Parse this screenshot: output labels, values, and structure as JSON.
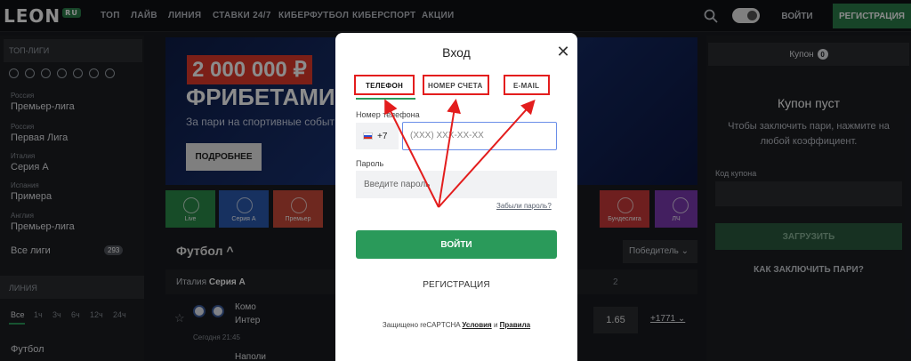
{
  "header": {
    "logo": "LEON",
    "logo_badge": "RU",
    "nav": [
      "ТОП",
      "ЛАЙВ",
      "ЛИНИЯ",
      "СТАВКИ 24/7",
      "КИБЕРФУТБОЛ",
      "КИБЕРСПОРТ",
      "АКЦИИ"
    ],
    "login": "ВОЙТИ",
    "register": "РЕГИСТРАЦИЯ"
  },
  "sidebar": {
    "top_leagues": "ТОП-ЛИГИ",
    "leagues": [
      {
        "country": "Россия",
        "name": "Премьер-лига"
      },
      {
        "country": "Россия",
        "name": "Первая Лига"
      },
      {
        "country": "Италия",
        "name": "Серия A"
      },
      {
        "country": "Испания",
        "name": "Примера"
      },
      {
        "country": "Англия",
        "name": "Премьер-лига"
      }
    ],
    "all_leagues": "Все лиги",
    "all_count": "293",
    "line": "ЛИНИЯ",
    "filters": [
      "Все",
      "1ч",
      "3ч",
      "6ч",
      "12ч",
      "24ч"
    ],
    "sport": "Футбол"
  },
  "banner": {
    "amount": "2 000 000 ₽",
    "title": "ФРИБЕТАМИ",
    "subtitle": "За пари на спортивные событ",
    "button": "ПОДРОБНЕЕ"
  },
  "tiles": [
    {
      "label": "Live",
      "color": "#2a8a4a"
    },
    {
      "label": "Серия А",
      "color": "#2a5ab0"
    },
    {
      "label": "Премьер",
      "color": "#c84a3a"
    },
    {
      "label": "Бундеслига",
      "color": "#c83a3a"
    },
    {
      "label": "ЛЧ",
      "color": "#7a3ab0"
    }
  ],
  "main": {
    "section": "Футбол",
    "sort": "Победитель",
    "league_country": "Италия",
    "league_name": "Серия A",
    "col_header": "2",
    "team1": "Комо",
    "team2": "Интер",
    "team3": "Наполи",
    "match_date": "Сегодня 21:45",
    "odds": "1.65",
    "more_markets": "+1771"
  },
  "coupon": {
    "title": "Купон",
    "count": "0",
    "empty_title": "Купон пуст",
    "empty_text": "Чтобы заключить пари, нажмите на любой коэффициент.",
    "code_label": "Код купона",
    "load": "ЗАГРУЗИТЬ",
    "how": "КАК ЗАКЛЮЧИТЬ ПАРИ?"
  },
  "modal": {
    "title": "Вход",
    "tabs": [
      "ТЕЛЕФОН",
      "НОМЕР СЧЕТА",
      "E-MAIL"
    ],
    "phone_label": "Номер телефона",
    "country_code": "+7",
    "phone_placeholder": "(XXX) XXX-XX-XX",
    "password_label": "Пароль",
    "password_placeholder": "Введите пароль",
    "forgot": "Забыли пароль?",
    "submit": "ВОЙТИ",
    "register": "РЕГИСТРАЦИЯ",
    "footer_prefix": "Защищено reCAPTCHA",
    "footer_terms": "Условия",
    "footer_and": "и",
    "footer_privacy": "Правила"
  },
  "annotation_color": "#e31d1d",
  "accent": "#2a9a5a"
}
